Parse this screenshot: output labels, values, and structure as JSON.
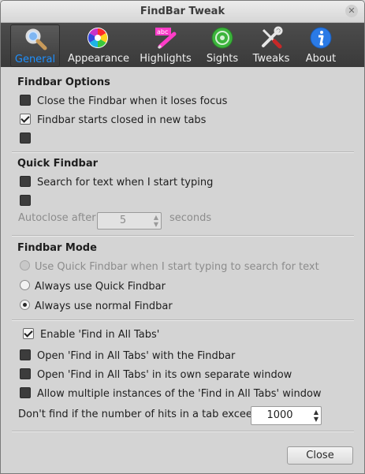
{
  "window": {
    "title": "FindBar Tweak"
  },
  "toolbar": {
    "items": [
      {
        "label": "General",
        "icon": "magnifier-icon",
        "active": true
      },
      {
        "label": "Appearance",
        "icon": "color-wheel-icon",
        "active": false
      },
      {
        "label": "Highlights",
        "icon": "highlighter-icon",
        "active": false
      },
      {
        "label": "Sights",
        "icon": "sights-icon",
        "active": false
      },
      {
        "label": "Tweaks",
        "icon": "tools-icon",
        "active": false
      },
      {
        "label": "About",
        "icon": "info-icon",
        "active": false
      }
    ],
    "highlight_badge": "abc"
  },
  "findbar_options": {
    "heading": "Findbar Options",
    "close_on_focus_loss": {
      "label": "Close the Findbar when it loses focus",
      "checked": false
    },
    "starts_closed": {
      "label": "Findbar starts closed in new tabs",
      "checked": true
    },
    "third": {
      "checked": false
    }
  },
  "quick_findbar": {
    "heading": "Quick Findbar",
    "search_when_typing": {
      "label": "Search for text when I start typing",
      "checked": false
    },
    "second": {
      "checked": false
    },
    "autoclose_label": "Autoclose after",
    "autoclose_value": "5",
    "autoclose_unit": "seconds"
  },
  "findbar_mode": {
    "heading": "Findbar Mode",
    "options": [
      {
        "label": "Use Quick Findbar when I start typing to search for text",
        "selected": false,
        "disabled": true
      },
      {
        "label": "Always use Quick Findbar",
        "selected": false,
        "disabled": false
      },
      {
        "label": "Always use normal Findbar",
        "selected": true,
        "disabled": false
      }
    ]
  },
  "find_all_tabs": {
    "enable": {
      "label": "Enable 'Find in All Tabs'",
      "checked": true
    },
    "open_with_findbar": {
      "label": "Open 'Find in All Tabs' with the Findbar",
      "checked": false
    },
    "open_separate": {
      "label": "Open 'Find in All Tabs' in its own separate window",
      "checked": false
    },
    "allow_multiple": {
      "label": "Allow multiple instances of the 'Find in All Tabs' window",
      "checked": false
    },
    "hits_label": "Don't find if the number of hits in a tab exceeds:",
    "hits_value": "1000"
  },
  "buttons": {
    "close": "Close"
  },
  "colors": {
    "accent": "#1e90ff",
    "toolbar_bg": "#3c3c3c",
    "window_bg": "#d4d4d4"
  }
}
